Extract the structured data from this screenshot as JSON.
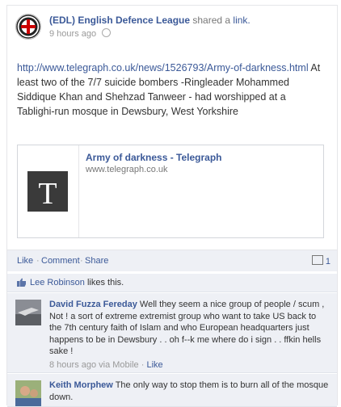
{
  "post": {
    "page_name": "(EDL) English Defence League",
    "shared_text": "shared a",
    "shared_link_word": "link.",
    "timestamp": "9 hours ago",
    "url": "http://www.telegraph.co.uk/news/1526793/Army-of-darkness.html",
    "message": "At least two of the 7/7 suicide bombers -Ringleader Mohammed Siddique Khan and Shehzad Tanweer - had worshipped at a Tablighi-run mosque in Dewsbury, West Yorkshire",
    "icons": {
      "avatar": "edl-avatar",
      "privacy": "globe-icon"
    }
  },
  "link_preview": {
    "title": "Army of darkness - Telegraph",
    "domain": "www.telegraph.co.uk",
    "thumb_letter": "T"
  },
  "actions": {
    "like": "Like",
    "comment": "Comment",
    "share": "Share",
    "separator": "·",
    "comment_count": "1"
  },
  "likes": {
    "name": "Lee Robinson",
    "text": "likes this."
  },
  "comments": [
    {
      "author": "David Fuzza Fereday",
      "text": "Well they seem a nice group of people / scum , Not ! a sort of extreme extremist group who want to take US back to the 7th century faith of Islam and who European headquarters just happens to be in Dewsbury . . oh f--k me where do i sign . . ffkin hells sake !",
      "time": "8 hours ago via Mobile",
      "like": "Like",
      "dot": "·"
    },
    {
      "author": "Keith Morphew",
      "text": "The only way to stop them is to burn all of the mosque down.",
      "time": "",
      "like": "",
      "dot": ""
    }
  ],
  "colors": {
    "link": "#3b5998",
    "meta": "#999999",
    "panel": "#eef0f5"
  }
}
